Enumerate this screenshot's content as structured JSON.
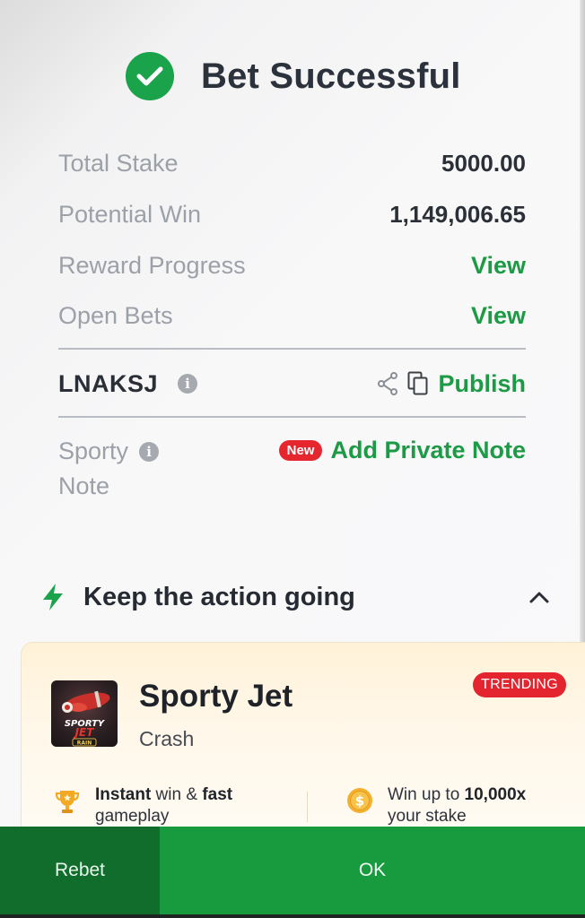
{
  "header": {
    "title": "Bet Successful",
    "icon": "check-circle-icon"
  },
  "summary": {
    "total_stake_label": "Total Stake",
    "total_stake_value": "5000.00",
    "potential_win_label": "Potential Win",
    "potential_win_value": "1,149,006.65",
    "reward_progress_label": "Reward Progress",
    "reward_progress_link": "View",
    "open_bets_label": "Open Bets",
    "open_bets_link": "View"
  },
  "booking": {
    "code": "LNAKSJ",
    "publish_label": "Publish"
  },
  "note": {
    "label_line1": "Sporty",
    "label_line2": "Note",
    "new_badge": "New",
    "add_label": "Add Private Note"
  },
  "promo": {
    "section_title": "Keep the action going",
    "game_name": "Sporty Jet",
    "game_category": "Crash",
    "badge": "TRENDING",
    "thumb_text_1": "SPORTY",
    "thumb_text_2": "JET",
    "thumb_text_3": "RAIN",
    "feature1_bold1": "Instant",
    "feature1_text1": " win & ",
    "feature1_bold2": "fast",
    "feature1_line2": "gameplay",
    "feature2_text1": "Win up to ",
    "feature2_bold": "10,000x",
    "feature2_line2": "your stake"
  },
  "footer": {
    "rebet_label": "Rebet",
    "ok_label": "OK"
  },
  "colors": {
    "accent_green": "#1c9a45",
    "badge_red": "#e5262f",
    "ok_green": "#189a3f",
    "rebet_green": "#116d2c"
  }
}
